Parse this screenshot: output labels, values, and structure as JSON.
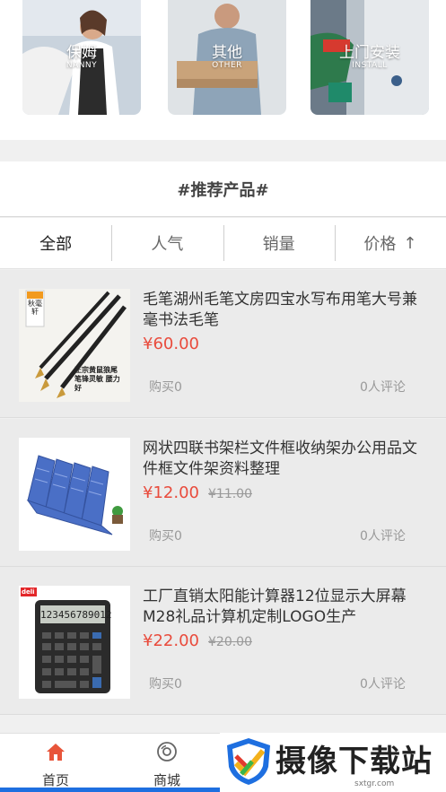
{
  "services": [
    {
      "title": "保姆",
      "subtitle": "NANNY"
    },
    {
      "title": "其他",
      "subtitle": "OTHER"
    },
    {
      "title": "上门安装",
      "subtitle": "INSTALL"
    }
  ],
  "recommend": {
    "title": "#推荐产品#"
  },
  "tabs": [
    {
      "label": "全部",
      "active": true
    },
    {
      "label": "人气"
    },
    {
      "label": "销量"
    },
    {
      "label": "价格",
      "arrow": "↑"
    }
  ],
  "products": [
    {
      "name": "毛笔湖州毛笔文房四宝水写布用笔大号兼毫书法毛笔",
      "price": "¥60.00",
      "old_price": "",
      "buy": "购买0",
      "comments": "0人评论",
      "thumb_texts": {
        "tag": "秋毫轩",
        "caption": "正宗黄鼠狼尾 笔锋灵敏 腰力好"
      }
    },
    {
      "name": "网状四联书架栏文件框收纳架办公用品文件框文件架资料整理",
      "price": "¥12.00",
      "old_price": "¥11.00",
      "buy": "购买0",
      "comments": "0人评论"
    },
    {
      "name": "工厂直销太阳能计算器12位显示大屏幕M28礼品计算机定制LOGO生产",
      "price": "¥22.00",
      "old_price": "¥20.00",
      "buy": "购买0",
      "comments": "0人评论",
      "thumb_texts": {
        "brand": "deli",
        "display": "123456789012"
      }
    }
  ],
  "nav": [
    {
      "label": "首页",
      "icon": "home-icon",
      "color": "#e8553a"
    },
    {
      "label": "商城",
      "icon": "mall-icon",
      "color": "#666666"
    }
  ],
  "watermark": {
    "text": "摄像下载站",
    "url": "sxtgr.com"
  },
  "colors": {
    "price": "#e94b3c",
    "accent": "#1e6fe0"
  }
}
